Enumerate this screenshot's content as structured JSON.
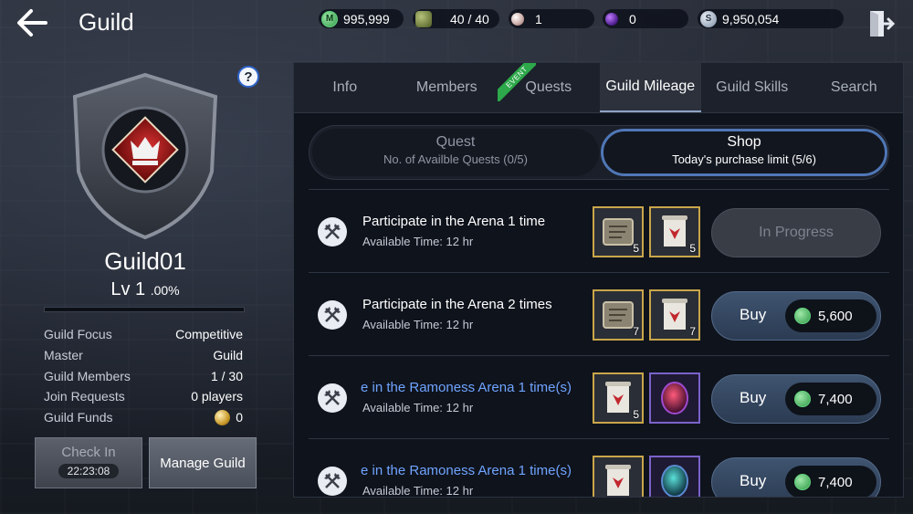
{
  "header": {
    "title": "Guild",
    "currencies": [
      {
        "icon": "mileage-icon",
        "value": "995,999"
      },
      {
        "icon": "stamina-icon",
        "value": "40 / 40"
      },
      {
        "icon": "pearl-icon",
        "value": "1"
      },
      {
        "icon": "orb-icon",
        "value": "0"
      },
      {
        "icon": "silver-icon",
        "value": "9,950,054"
      }
    ]
  },
  "guild": {
    "name": "Guild01",
    "level": "Lv 1",
    "percent": ".00%",
    "xp_fraction": 0,
    "stats": [
      {
        "key": "Guild Focus",
        "value": "Competitive"
      },
      {
        "key": "Master",
        "value": "Guild"
      },
      {
        "key": "Guild Members",
        "value": "1 / 30"
      },
      {
        "key": "Join Requests",
        "value": "0 players"
      },
      {
        "key": "Guild Funds",
        "value": "0"
      }
    ],
    "check_in": {
      "label": "Check In",
      "timer": "22:23:08"
    },
    "manage_label": "Manage Guild",
    "help_label": "?"
  },
  "tabs": [
    {
      "label": "Info"
    },
    {
      "label": "Members"
    },
    {
      "label": "Quests",
      "badge": "EVENT"
    },
    {
      "label": "Guild Mileage",
      "active": true
    },
    {
      "label": "Guild Skills"
    },
    {
      "label": "Search"
    }
  ],
  "toggle": {
    "quest": {
      "title": "Quest",
      "subtitle": "No. of Availble Quests (0/5)"
    },
    "shop": {
      "title": "Shop",
      "subtitle": "Today's purchase limit (5/6)"
    }
  },
  "rows": [
    {
      "title": "Participate in the Arena 1 time",
      "subtitle": "Available Time: 12 hr",
      "items": [
        {
          "icon": "tablet-icon",
          "qty": "5"
        },
        {
          "icon": "scroll-icon",
          "qty": "5"
        }
      ],
      "action": "In Progress"
    },
    {
      "title": "Participate in the Arena 2 times",
      "subtitle": "Available Time: 12 hr",
      "items": [
        {
          "icon": "tablet-icon",
          "qty": "7"
        },
        {
          "icon": "scroll-icon",
          "qty": "7"
        }
      ],
      "action": "Buy",
      "price": "5,600"
    },
    {
      "title": "e in the Ramoness Arena 1 time(s)",
      "subtitle": "Available Time: 12 hr",
      "items": [
        {
          "icon": "scroll-icon",
          "qty": "5"
        },
        {
          "icon": "red-gem-icon",
          "qty": ""
        }
      ],
      "action": "Buy",
      "price": "7,400"
    },
    {
      "title": "e in the Ramoness Arena 1 time(s)",
      "subtitle": "Available Time: 12 hr",
      "items": [
        {
          "icon": "scroll-icon",
          "qty": ""
        },
        {
          "icon": "teal-gem-icon",
          "qty": ""
        }
      ],
      "action": "Buy",
      "price": "7,400"
    }
  ],
  "colors": {
    "accent": "#4f77b6",
    "link": "#6fa4ff",
    "event": "#2da84a"
  }
}
